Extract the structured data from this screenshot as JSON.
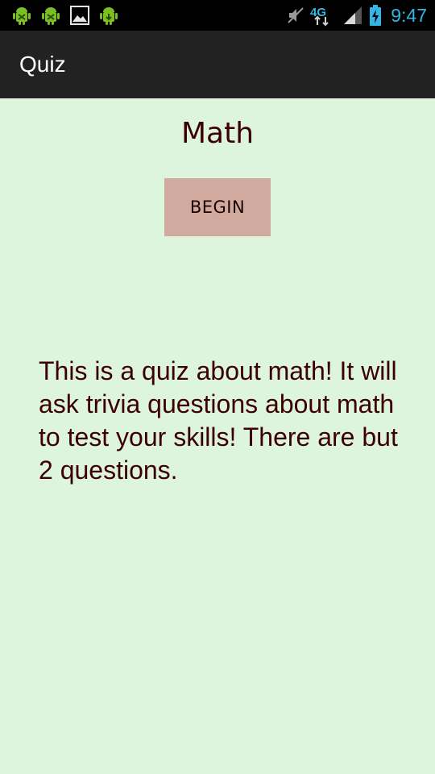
{
  "status_bar": {
    "notification_icons": [
      "android-debug-icon",
      "android-warning-icon",
      "picture-icon",
      "android-download-icon"
    ],
    "network_label": "4G",
    "time": "9:47",
    "clock_color": "#33b5e5"
  },
  "action_bar": {
    "title": "Quiz"
  },
  "quiz": {
    "title": "Math",
    "begin_label": "BEGIN",
    "description": "This is a quiz about math! It will ask trivia questions about math to test your skills! There are but 2 questions."
  },
  "colors": {
    "background": "#dcf5dc",
    "action_bar": "#222222",
    "status_bar": "#000000",
    "text": "#3d0000",
    "button": "#d0aa9e"
  }
}
